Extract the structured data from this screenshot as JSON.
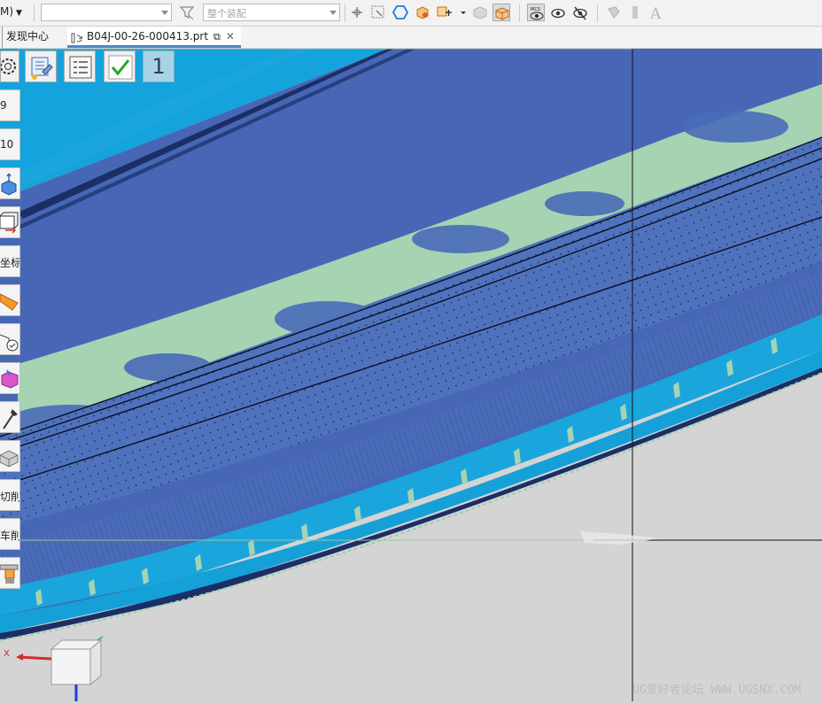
{
  "toolbar": {
    "menu_label": "M)",
    "filter_combo_value": "",
    "assembly_combo_placeholder": "整个装配",
    "icons": [
      "filter-icon",
      "select-face-icon",
      "select-component-icon",
      "hexagon-icon",
      "point-snap-icon",
      "box-select-icon",
      "dropdown-icon",
      "solid-gray-icon",
      "solid-shaded-icon",
      "mcs-eye-icon",
      "show-eye-icon",
      "hide-eye-icon",
      "stamp-icon",
      "bar-icon",
      "text-a-icon"
    ]
  },
  "tabs": {
    "discover": "发现中心",
    "file": "B04J-00-26-000413.prt"
  },
  "palette": {
    "items": [
      "9",
      "10",
      "",
      "",
      "坐标",
      "",
      "",
      "",
      "",
      "",
      "切削",
      "车削",
      ""
    ]
  },
  "commands": {
    "number_label": "1"
  },
  "axis": {
    "x_label": "X"
  },
  "watermark": "UG爱好者论坛 WWW.UGSNX.COM",
  "colors": {
    "sky_blue": "#1aa6dd",
    "dark_blue": "#4a6bb8",
    "light_green": "#a6d3b2",
    "background_gray": "#d4d4d4"
  }
}
